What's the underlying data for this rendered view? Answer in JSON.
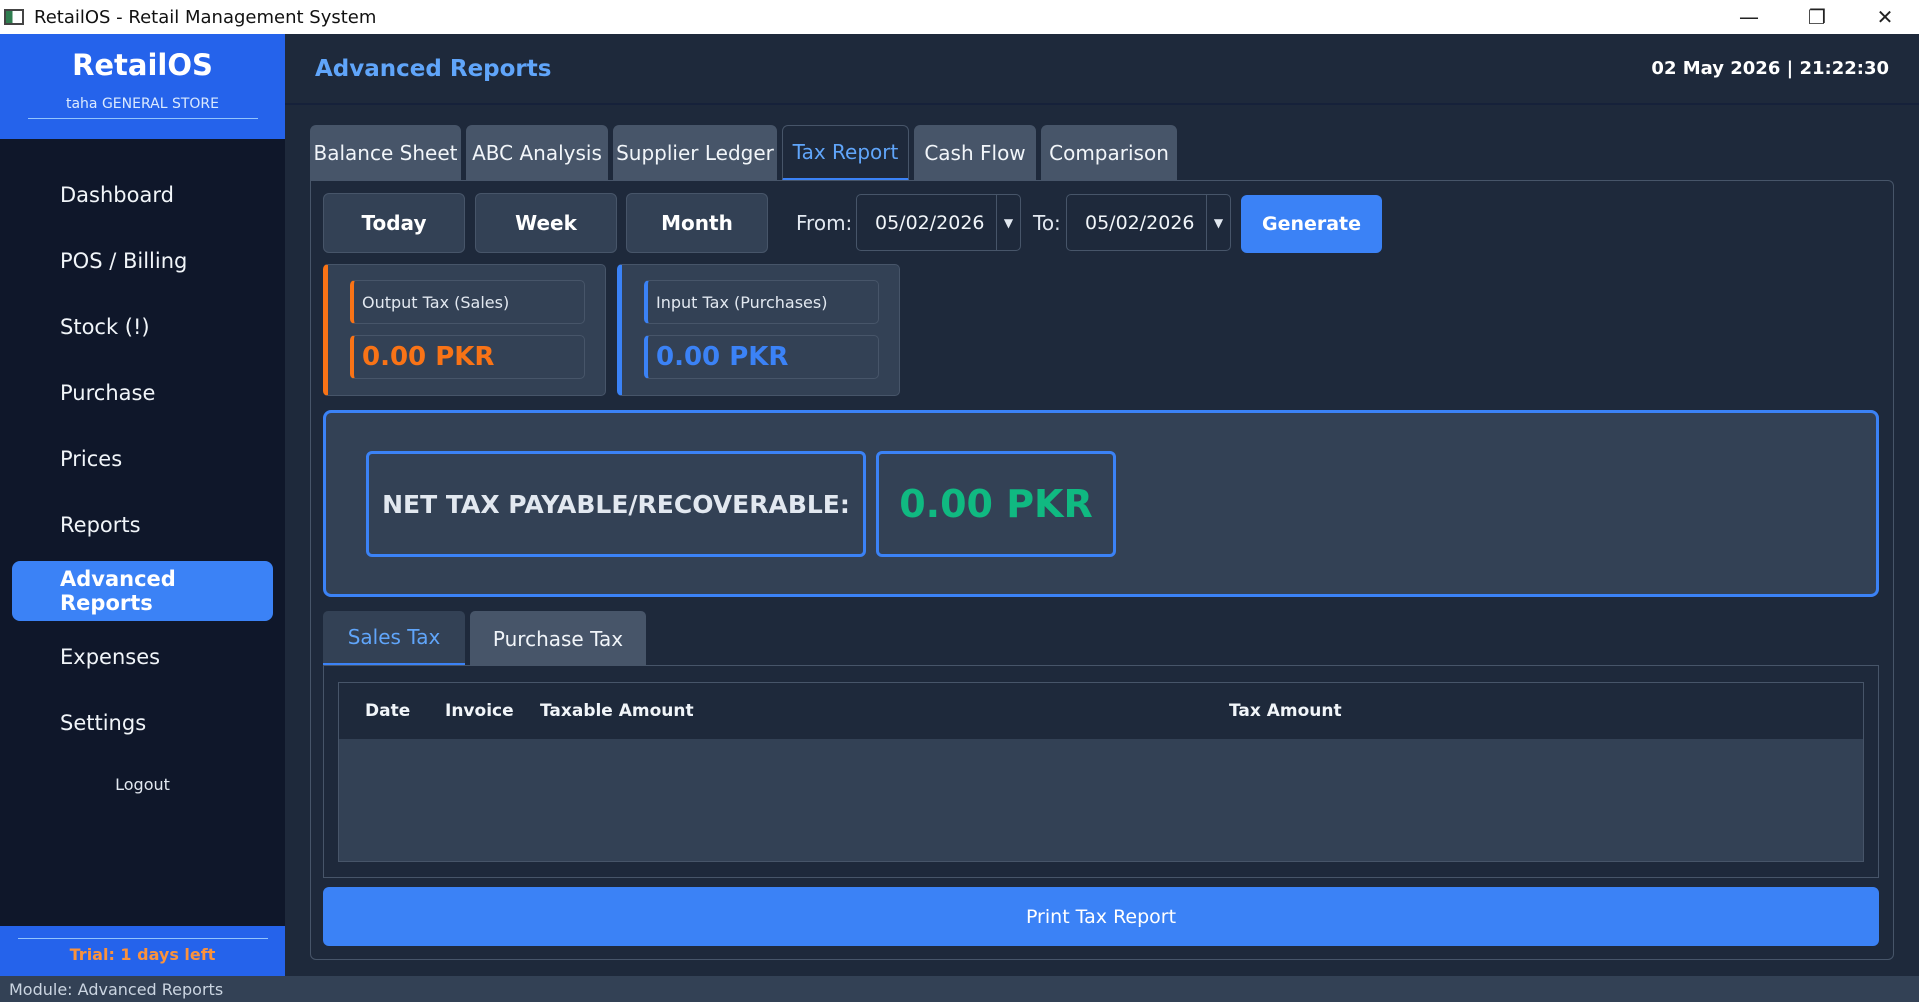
{
  "window": {
    "title": "RetailOS - Retail Management System",
    "minimize": "—",
    "restore": "❐",
    "close": "✕"
  },
  "sidebar": {
    "brand": "RetailOS",
    "store": "taha GENERAL STORE",
    "items": [
      {
        "label": "Dashboard"
      },
      {
        "label": "POS / Billing"
      },
      {
        "label": "Stock (!)"
      },
      {
        "label": "Purchase"
      },
      {
        "label": "Prices"
      },
      {
        "label": "Reports"
      },
      {
        "label": "Advanced Reports"
      },
      {
        "label": "Expenses"
      },
      {
        "label": "Settings"
      }
    ],
    "logout": "Logout",
    "trial": "Trial: 1 days left"
  },
  "header": {
    "title": "Advanced Reports",
    "datetime": "02 May 2026  |  21:22:30"
  },
  "tabs": [
    {
      "label": "Balance Sheet"
    },
    {
      "label": "ABC Analysis"
    },
    {
      "label": "Supplier Ledger"
    },
    {
      "label": "Tax Report"
    },
    {
      "label": "Cash Flow"
    },
    {
      "label": "Comparison"
    }
  ],
  "filters": {
    "today": "Today",
    "week": "Week",
    "month": "Month",
    "from_label": "From:",
    "from_value": "05/02/2026",
    "to_label": "To:",
    "to_value": "05/02/2026",
    "generate": "Generate"
  },
  "cards": {
    "output_label": "Output Tax (Sales)",
    "output_value": "0.00 PKR",
    "input_label": "Input Tax (Purchases)",
    "input_value": "0.00 PKR"
  },
  "net": {
    "label": "NET TAX PAYABLE/RECOVERABLE:",
    "value": "0.00 PKR"
  },
  "subtabs": [
    {
      "label": "Sales Tax"
    },
    {
      "label": "Purchase Tax"
    }
  ],
  "table": {
    "columns": [
      "Date",
      "Invoice",
      "Taxable Amount",
      "Tax Amount"
    ]
  },
  "print": "Print Tax Report",
  "status": "Module: Advanced Reports",
  "colors": {
    "accent": "#3b82f6",
    "output": "#f97316",
    "net": "#10b981",
    "trial": "#fb923c"
  }
}
